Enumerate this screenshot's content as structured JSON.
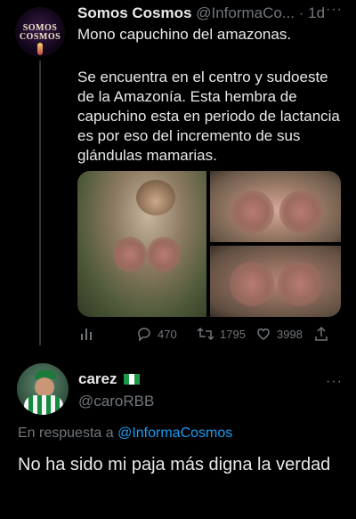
{
  "tweet": {
    "author_name": "Somos Cosmos",
    "author_handle": "@InformaCo...",
    "time": "· 1d",
    "avatar_logo_top": "SOMOS COSMOS",
    "avatar_logo_line1": "SOMOS",
    "avatar_logo_line2": "COSMOS",
    "text_line1": "Mono capuchino del amazonas.",
    "text_body": "Se encuentra en el centro y sudoeste de la Amazonía. Esta hembra de capuchino esta en periodo de lactancia es por eso del incremento de sus glándulas mamarias.",
    "actions": {
      "replies": "470",
      "retweets": "1795",
      "likes": "3998"
    }
  },
  "reply": {
    "author_name": "carez",
    "author_handle": "@caroRBB",
    "replying_prefix": "En respuesta a",
    "replying_to": "@InformaCosmos",
    "text": "No ha sido mi paja más digna la verdad"
  },
  "icons": [
    "more-icon",
    "analytics-icon",
    "reply-icon",
    "retweet-icon",
    "like-icon",
    "share-icon",
    "flag-icon"
  ],
  "colors": {
    "background": "#000000",
    "text": "#e7e9ea",
    "secondary": "#71767b",
    "link": "#1d9bf0",
    "thread_line": "#333639"
  }
}
